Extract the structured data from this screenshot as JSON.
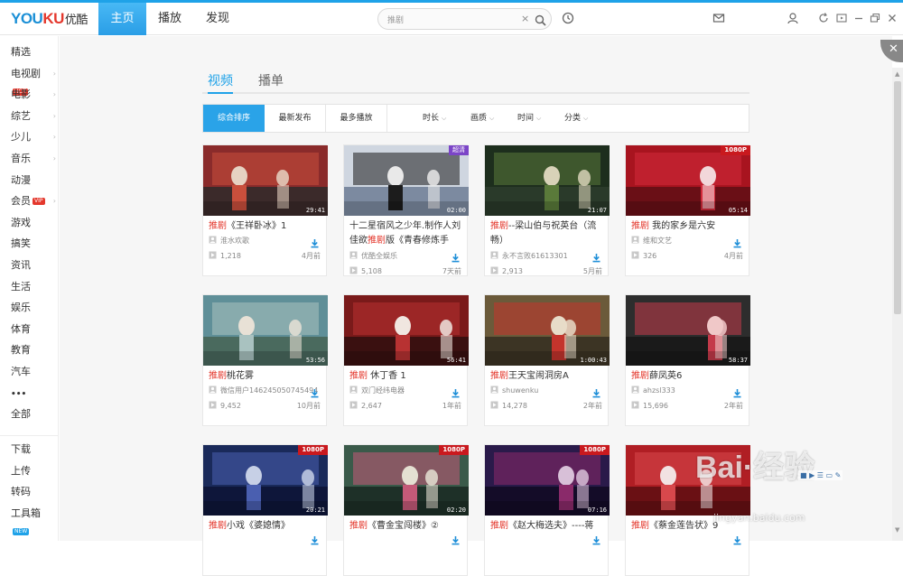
{
  "app": {
    "logo": {
      "part1": "YOU",
      "part2": "KU",
      "cn": "优酷"
    },
    "nav": [
      {
        "label": "主页",
        "active": true
      },
      {
        "label": "播放",
        "active": false
      },
      {
        "label": "发现",
        "active": false
      }
    ],
    "search": {
      "value": "推剧",
      "clear_icon": "×"
    },
    "accent_color": "#1fa2e8",
    "highlight_color": "#e4382d"
  },
  "sidebar": {
    "items": [
      {
        "label": "精选",
        "badge": "",
        "arrow": ""
      },
      {
        "label": "电视剧",
        "badge": "HOT",
        "arrow": "›"
      },
      {
        "label": "电影",
        "badge": "",
        "arrow": "›"
      },
      {
        "label": "综艺",
        "badge": "",
        "arrow": "›"
      },
      {
        "label": "少儿",
        "badge": "",
        "arrow": "›"
      },
      {
        "label": "音乐",
        "badge": "",
        "arrow": "›"
      },
      {
        "label": "动漫",
        "badge": "",
        "arrow": ""
      },
      {
        "label": "会员",
        "badge": "VIP",
        "arrow": "›"
      },
      {
        "label": "游戏",
        "badge": "",
        "arrow": ""
      },
      {
        "label": "搞笑",
        "badge": "",
        "arrow": ""
      },
      {
        "label": "资讯",
        "badge": "",
        "arrow": ""
      },
      {
        "label": "生活",
        "badge": "",
        "arrow": ""
      },
      {
        "label": "娱乐",
        "badge": "",
        "arrow": ""
      },
      {
        "label": "体育",
        "badge": "",
        "arrow": ""
      },
      {
        "label": "教育",
        "badge": "",
        "arrow": ""
      },
      {
        "label": "汽车",
        "badge": "",
        "arrow": ""
      },
      {
        "label": "•••",
        "badge": "",
        "arrow": ""
      },
      {
        "label": "全部",
        "badge": "",
        "arrow": ""
      }
    ],
    "tools": [
      {
        "label": "下载",
        "badge": ""
      },
      {
        "label": "上传",
        "badge": ""
      },
      {
        "label": "转码",
        "badge": ""
      },
      {
        "label": "工具箱",
        "badge": "NEW"
      }
    ]
  },
  "main": {
    "tabs": [
      {
        "label": "视频",
        "active": true
      },
      {
        "label": "播单",
        "active": false
      }
    ],
    "sort_buttons": [
      {
        "label": "综合排序",
        "active": true
      },
      {
        "label": "最新发布",
        "active": false
      },
      {
        "label": "最多播放",
        "active": false
      }
    ],
    "dropdowns": [
      {
        "label": "时长",
        "chevron": "⌵"
      },
      {
        "label": "画质",
        "chevron": "⌵"
      },
      {
        "label": "时间",
        "chevron": "⌵"
      },
      {
        "label": "分类",
        "chevron": "⌵"
      }
    ],
    "videos": [
      {
        "pre": "",
        "hl": "推剧",
        "post": "《王祥卧冰》1",
        "user": "淮水欢歌",
        "plays": "1,218",
        "time": "4月前",
        "duration": "29:41",
        "flag": "",
        "palette": [
          "#8a2b2b",
          "#c94f3c",
          "#e6d2c2",
          "#3b2a2a"
        ]
      },
      {
        "pre": "十二星宿风之少年.制作人刘佳欲",
        "hl": "推剧",
        "post": "版《青春修炼手",
        "user": "优酷全娱乐",
        "plays": "5,108",
        "time": "7天前",
        "duration": "02:00",
        "flag": "超清",
        "palette": [
          "#cfd6e0",
          "#1c1c1c",
          "#e9e9e9",
          "#7c8aa0"
        ]
      },
      {
        "pre": "",
        "hl": "推剧",
        "post": "--梁山伯与祝英台（流畅）",
        "user": "永不言败61613301",
        "plays": "2,913",
        "time": "5月前",
        "duration": "21:07",
        "flag": "",
        "palette": [
          "#1d2e1d",
          "#5a7a3a",
          "#d8d2b8",
          "#2a3a2a"
        ]
      },
      {
        "pre": "",
        "hl": "推剧",
        "post": " 我的家乡是六安",
        "user": "维和文艺",
        "plays": "326",
        "time": "4月前",
        "duration": "05:14",
        "flag": "1080P",
        "palette": [
          "#a8141f",
          "#d22a3a",
          "#f2d7d9",
          "#6a0f16"
        ]
      },
      {
        "pre": "",
        "hl": "推剧",
        "post": "桃花雾",
        "user": "微信用户146245050745494",
        "plays": "9,452",
        "time": "10月前",
        "duration": "53:56",
        "flag": "",
        "palette": [
          "#5f8f98",
          "#a9c2c0",
          "#e8e1d6",
          "#4a6a5e"
        ]
      },
      {
        "pre": "",
        "hl": "推剧",
        "post": " 休丁香 1",
        "user": "双门经纬电器",
        "plays": "2,647",
        "time": "1年前",
        "duration": "56:41",
        "flag": "",
        "palette": [
          "#7a1a1a",
          "#b83232",
          "#f0e6e0",
          "#3a1010"
        ]
      },
      {
        "pre": "",
        "hl": "推剧",
        "post": "王天宝闹洞房A",
        "user": "shuwenku",
        "plays": "14,278",
        "time": "2年前",
        "duration": "1:00:43",
        "flag": "",
        "palette": [
          "#6b5a3a",
          "#c4342c",
          "#e7dcc8",
          "#3c3424"
        ]
      },
      {
        "pre": "",
        "hl": "推剧",
        "post": "薛凤英6",
        "user": "ahzsl333",
        "plays": "15,696",
        "time": "2年前",
        "duration": "58:37",
        "flag": "",
        "palette": [
          "#2d2d2d",
          "#c43a4a",
          "#f0c8c8",
          "#1a1a1a"
        ]
      },
      {
        "pre": "",
        "hl": "推剧",
        "post": "小戏《婆媳情》",
        "user": "",
        "plays": "",
        "time": "",
        "duration": "20:21",
        "flag": "1080P",
        "palette": [
          "#1a2a5a",
          "#4a5fb0",
          "#c7d0e6",
          "#0e163a"
        ]
      },
      {
        "pre": "",
        "hl": "推剧",
        "post": "《曹金宝闯楼》②",
        "user": "",
        "plays": "",
        "time": "",
        "duration": "02:20",
        "flag": "1080P",
        "palette": [
          "#3a5a4a",
          "#c45a78",
          "#e4e0d2",
          "#1e3028"
        ]
      },
      {
        "pre": "",
        "hl": "推剧",
        "post": "《赵大梅选夫》----蒋",
        "user": "",
        "plays": "",
        "time": "",
        "duration": "07:16",
        "flag": "1080P",
        "palette": [
          "#2a1a4a",
          "#8a2a6a",
          "#d8c0d8",
          "#140c28"
        ]
      },
      {
        "pre": "",
        "hl": "推剧",
        "post": "《蔡金莲告状》9",
        "user": "",
        "plays": "",
        "time": "",
        "duration": "",
        "flag": "",
        "palette": [
          "#b01e24",
          "#d8484c",
          "#f2e2e2",
          "#6a1014"
        ]
      }
    ]
  },
  "watermark": {
    "text": "Bai·经验",
    "sub": "jingyan.baidu.com"
  }
}
